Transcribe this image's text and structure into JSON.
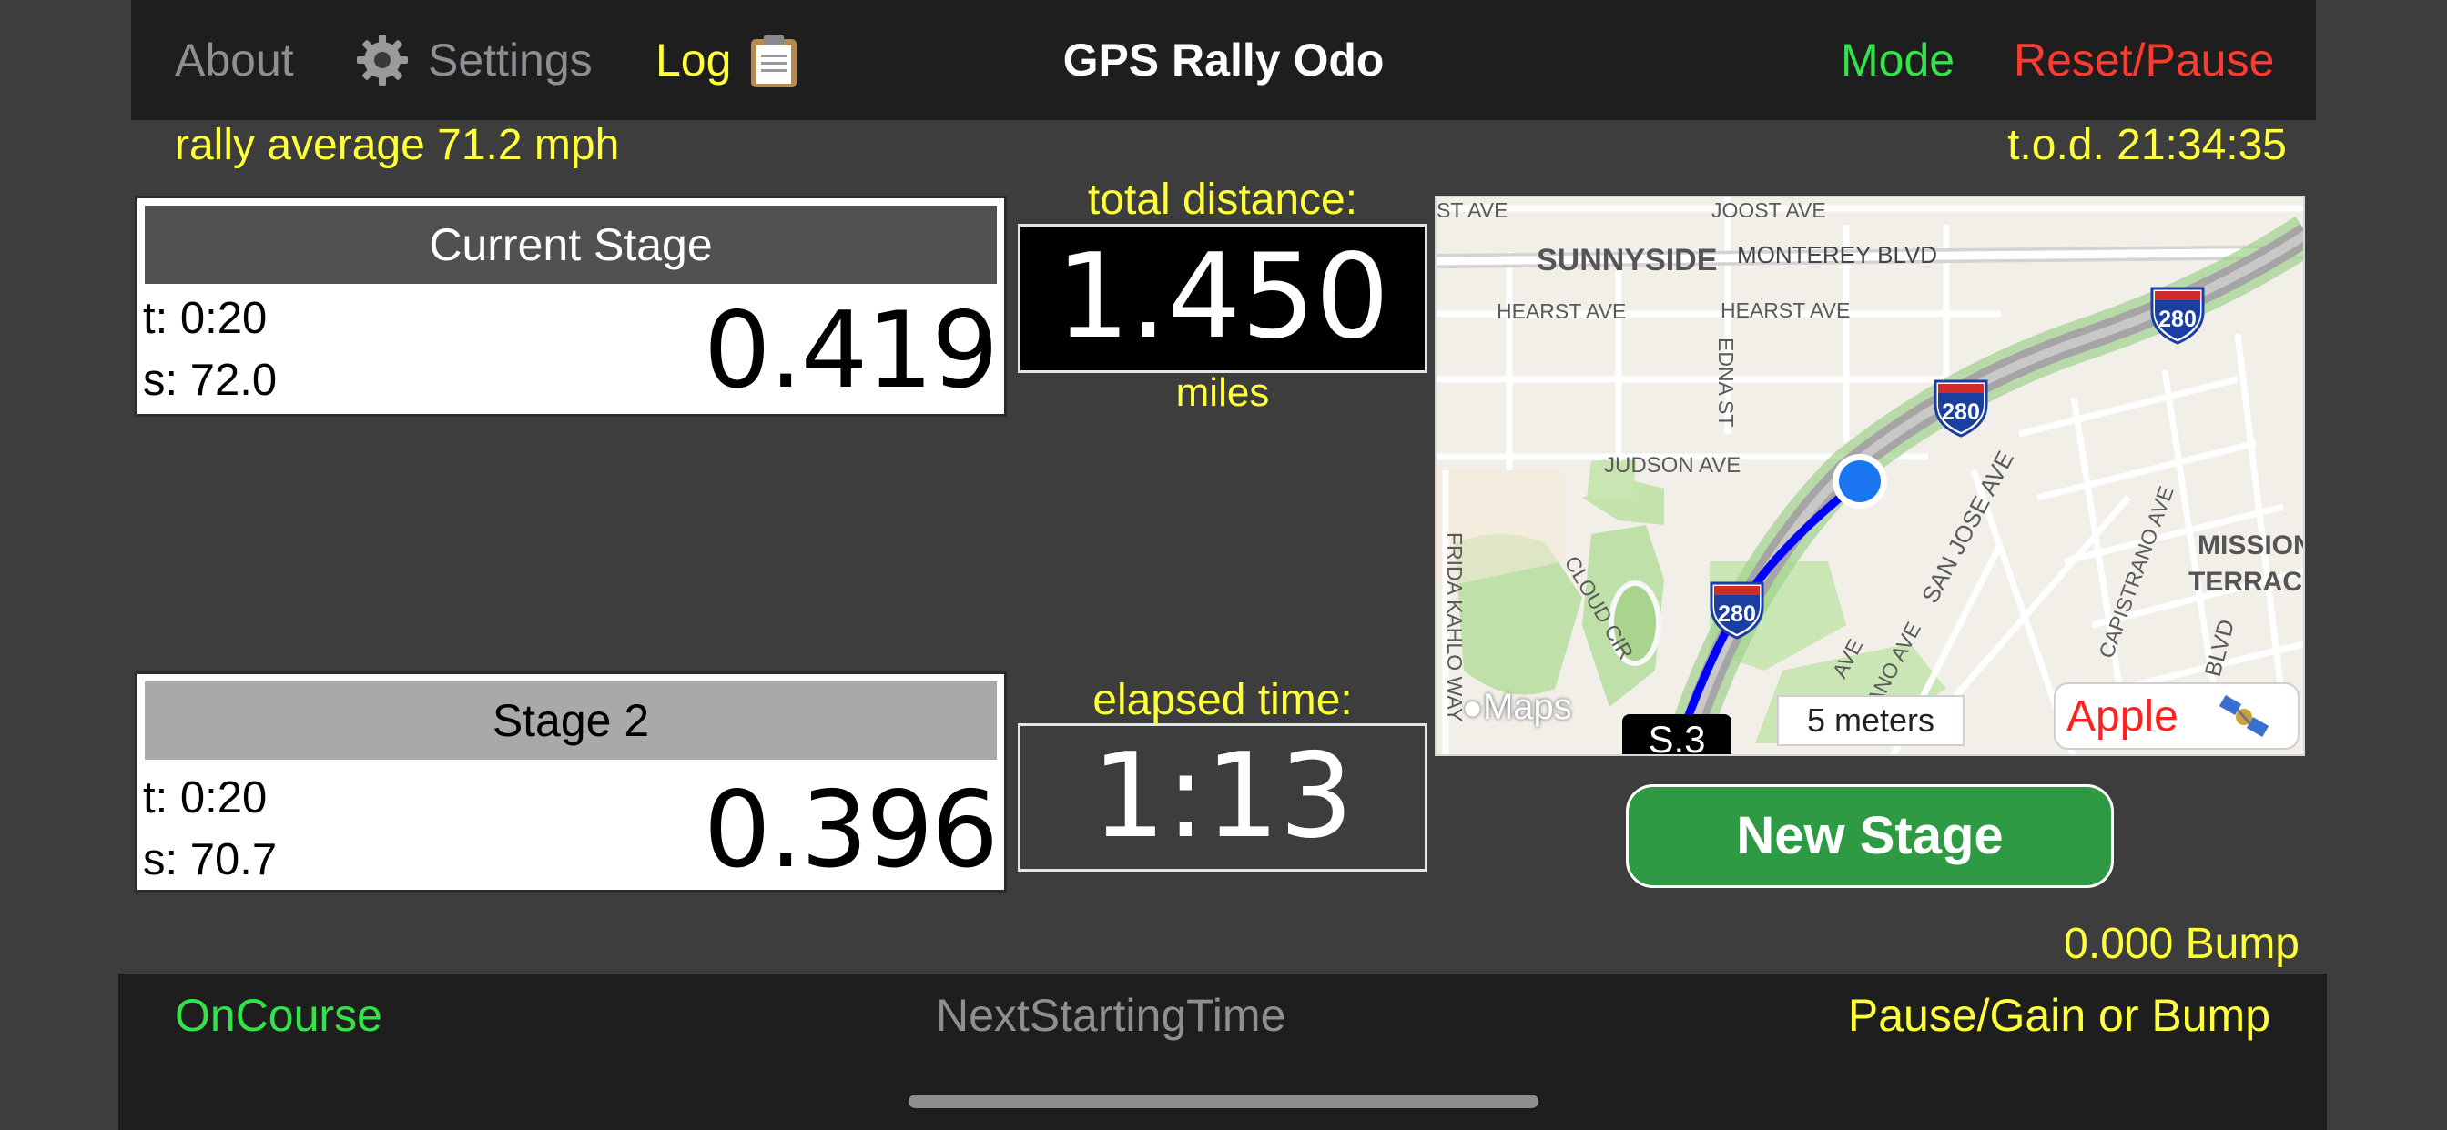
{
  "nav": {
    "about": "About",
    "settings": "Settings",
    "log": "Log",
    "title": "GPS Rally Odo",
    "mode": "Mode",
    "reset": "Reset/Pause"
  },
  "rally_average": "rally average 71.2 mph",
  "tod": "t.o.d. 21:34:35",
  "current_stage": {
    "header": "Current Stage",
    "time": "t: 0:20",
    "speed": "s: 72.0",
    "distance": "0.419"
  },
  "stage2": {
    "header": "Stage 2",
    "time": "t: 0:20",
    "speed": "s: 70.7",
    "distance": "0.396"
  },
  "total": {
    "label": "total distance:",
    "value": "1.450",
    "unit": "miles"
  },
  "elapsed": {
    "label": "elapsed time:",
    "value": "1:13"
  },
  "map": {
    "streets": {
      "joost_a": "ST AVE",
      "joost_b": "JOOST AVE",
      "sunnyside": "SUNNYSIDE",
      "monterey": "MONTEREY BLVD",
      "hearst_a": "HEARST AVE",
      "hearst_b": "HEARST AVE",
      "edna": "EDNA ST",
      "judson": "JUDSON AVE",
      "frida": "FRIDA KAHLO WAY",
      "cloud": "CLOUD CIR",
      "sanjose": "SAN JOSE AVE",
      "capistrano": "CAPISTRANO AVE",
      "blvd": "BLVD",
      "mission": "MISSION",
      "terrace": "TERRACE",
      "ano": "ANO AVE",
      "ave": "AVE"
    },
    "shields": [
      "280",
      "280",
      "280"
    ],
    "maps_brand": "Maps",
    "scale": "5 meters",
    "stage_marker": "S.3",
    "apple": "Apple"
  },
  "new_stage_button": "New Stage",
  "bump": "0.000 Bump",
  "bottom": {
    "oncourse": "OnCourse",
    "next": "NextStartingTime",
    "pause": "Pause/Gain or Bump"
  }
}
